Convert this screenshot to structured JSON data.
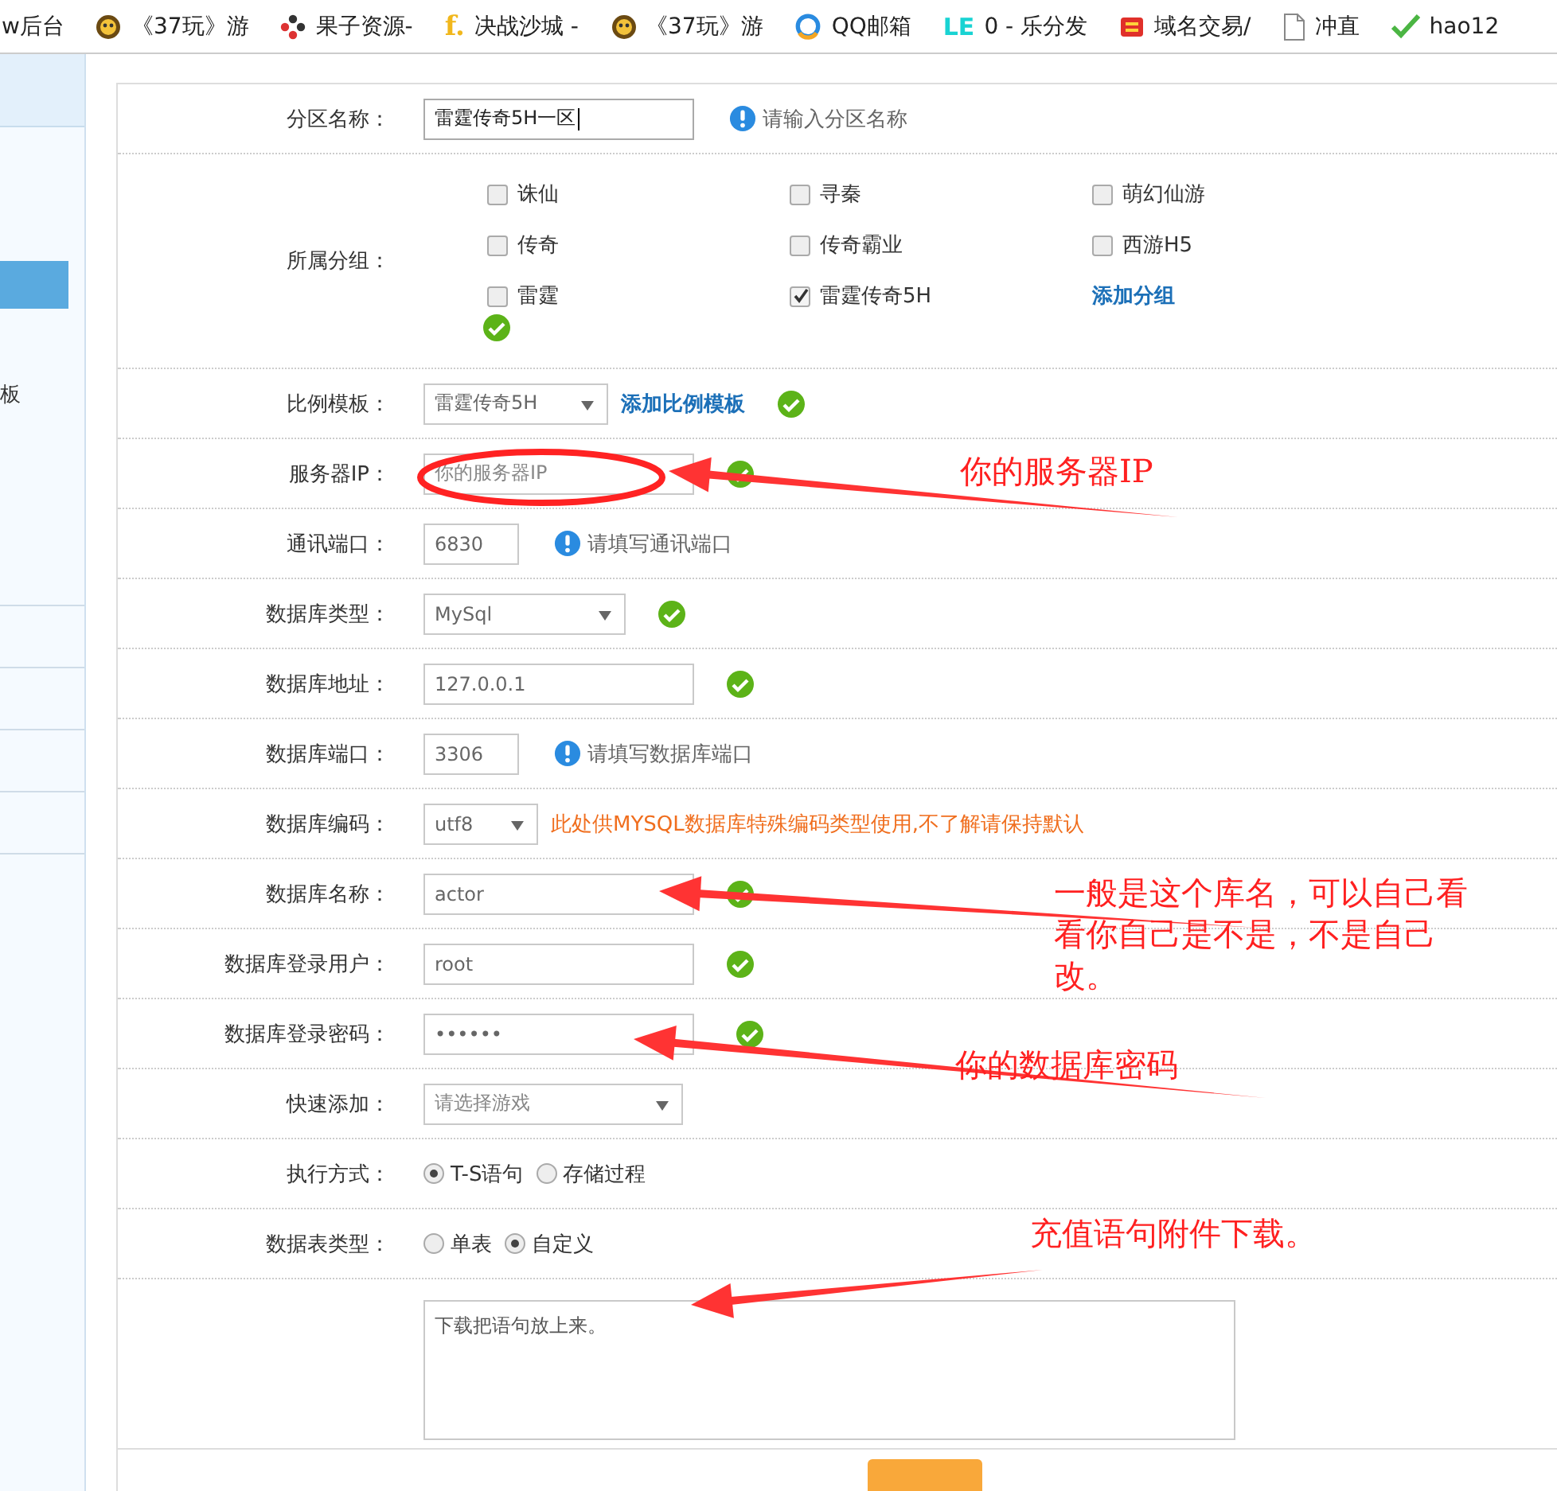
{
  "bookmarks": [
    {
      "label": "w后台"
    },
    {
      "label": "《37玩》游"
    },
    {
      "label": "果子资源-"
    },
    {
      "icon_text": "f.",
      "label": "决战沙城 -"
    },
    {
      "label": "《37玩》游"
    },
    {
      "label": "QQ邮箱"
    },
    {
      "icon_text": "LE",
      "label": "0 - 乐分发"
    },
    {
      "label": "域名交易/"
    },
    {
      "label": "冲直"
    },
    {
      "label": "hao12"
    }
  ],
  "sidebar": {
    "items": [
      {
        "selected": true
      },
      {
        "label": "板",
        "selected": false
      }
    ]
  },
  "form": {
    "rows": [
      {
        "label": "分区名称：",
        "kind": "text",
        "value": "雷霆传奇5H一区",
        "focused": true,
        "hint": {
          "kind": "info",
          "text": "请输入分区名称"
        }
      },
      {
        "label": "所属分组：",
        "kind": "checkgroup",
        "valid": true,
        "link": "添加分组",
        "options": [
          {
            "label": "诛仙",
            "checked": false
          },
          {
            "label": "寻秦",
            "checked": false
          },
          {
            "label": "萌幻仙游",
            "checked": false
          },
          {
            "label": "传奇",
            "checked": false
          },
          {
            "label": "传奇霸业",
            "checked": false
          },
          {
            "label": "西游H5",
            "checked": false
          },
          {
            "label": "雷霆",
            "checked": false
          },
          {
            "label": "雷霆传奇5H",
            "checked": true
          }
        ]
      },
      {
        "label": "比例模板：",
        "kind": "select",
        "value": "雷霆传奇5H",
        "link": "添加比例模板",
        "valid": true
      },
      {
        "label": "服务器IP：",
        "kind": "text",
        "placeholder": "你的服务器IP",
        "valid": true
      },
      {
        "label": "通讯端口：",
        "kind": "text",
        "value": "6830",
        "hint": {
          "kind": "info",
          "text": "请填写通讯端口"
        }
      },
      {
        "label": "数据库类型：",
        "kind": "select",
        "value": "MySql",
        "valid": true
      },
      {
        "label": "数据库地址：",
        "kind": "text",
        "value": "127.0.0.1",
        "valid": true
      },
      {
        "label": "数据库端口：",
        "kind": "text",
        "value": "3306",
        "hint": {
          "kind": "info",
          "text": "请填写数据库端口"
        }
      },
      {
        "label": "数据库编码：",
        "kind": "select",
        "value": "utf8",
        "hint": {
          "kind": "warning",
          "text": "此处供MYSQL数据库特殊编码类型使用,不了解请保持默认"
        }
      },
      {
        "label": "数据库名称：",
        "kind": "text",
        "value": "actor",
        "valid": true
      },
      {
        "label": "数据库登录用户：",
        "kind": "text",
        "value": "root",
        "valid": true
      },
      {
        "label": "数据库登录密码：",
        "kind": "password",
        "value": "••••••",
        "valid": true
      },
      {
        "label": "快速添加：",
        "kind": "select",
        "placeholder": "请选择游戏"
      },
      {
        "label": "执行方式：",
        "kind": "radio",
        "options": [
          {
            "label": "T-S语句",
            "selected": true
          },
          {
            "label": "存储过程",
            "selected": false
          }
        ]
      },
      {
        "label": "数据表类型：",
        "kind": "radio",
        "options": [
          {
            "label": "单表",
            "selected": false
          },
          {
            "label": "自定义",
            "selected": true
          }
        ]
      },
      {
        "kind": "textarea",
        "value": "下载把语句放上来。"
      }
    ]
  },
  "annotations": [
    {
      "text": "你的服务器IP"
    },
    {
      "text": "一般是这个库名，可以自己看看你自己是不是，不是自己改。"
    },
    {
      "text": "你的数据库密码"
    },
    {
      "text": "充值语句附件下载。"
    }
  ]
}
